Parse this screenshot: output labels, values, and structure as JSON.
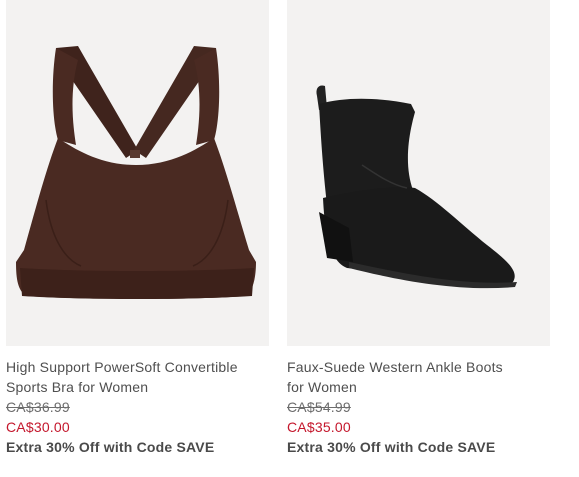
{
  "products": [
    {
      "image_alt": "brown-sports-bra",
      "name_line1": "High Support PowerSoft Convertible",
      "name_line2": "Sports Bra for Women",
      "original_price": "CA$36.99",
      "sale_price": "CA$30.00",
      "promo": "Extra 30% Off with Code SAVE"
    },
    {
      "image_alt": "black-ankle-boot",
      "name_line1": "Faux-Suede Western Ankle Boots",
      "name_line2": "for Women",
      "original_price": "CA$54.99",
      "sale_price": "CA$35.00",
      "promo": "Extra 30% Off with Code SAVE"
    }
  ],
  "colors": {
    "image_bg": "#f3f2f1",
    "sale": "#c4172c",
    "text": "#4f4f4f",
    "bra": "#4a2a22",
    "boot": "#1a1a1a"
  }
}
